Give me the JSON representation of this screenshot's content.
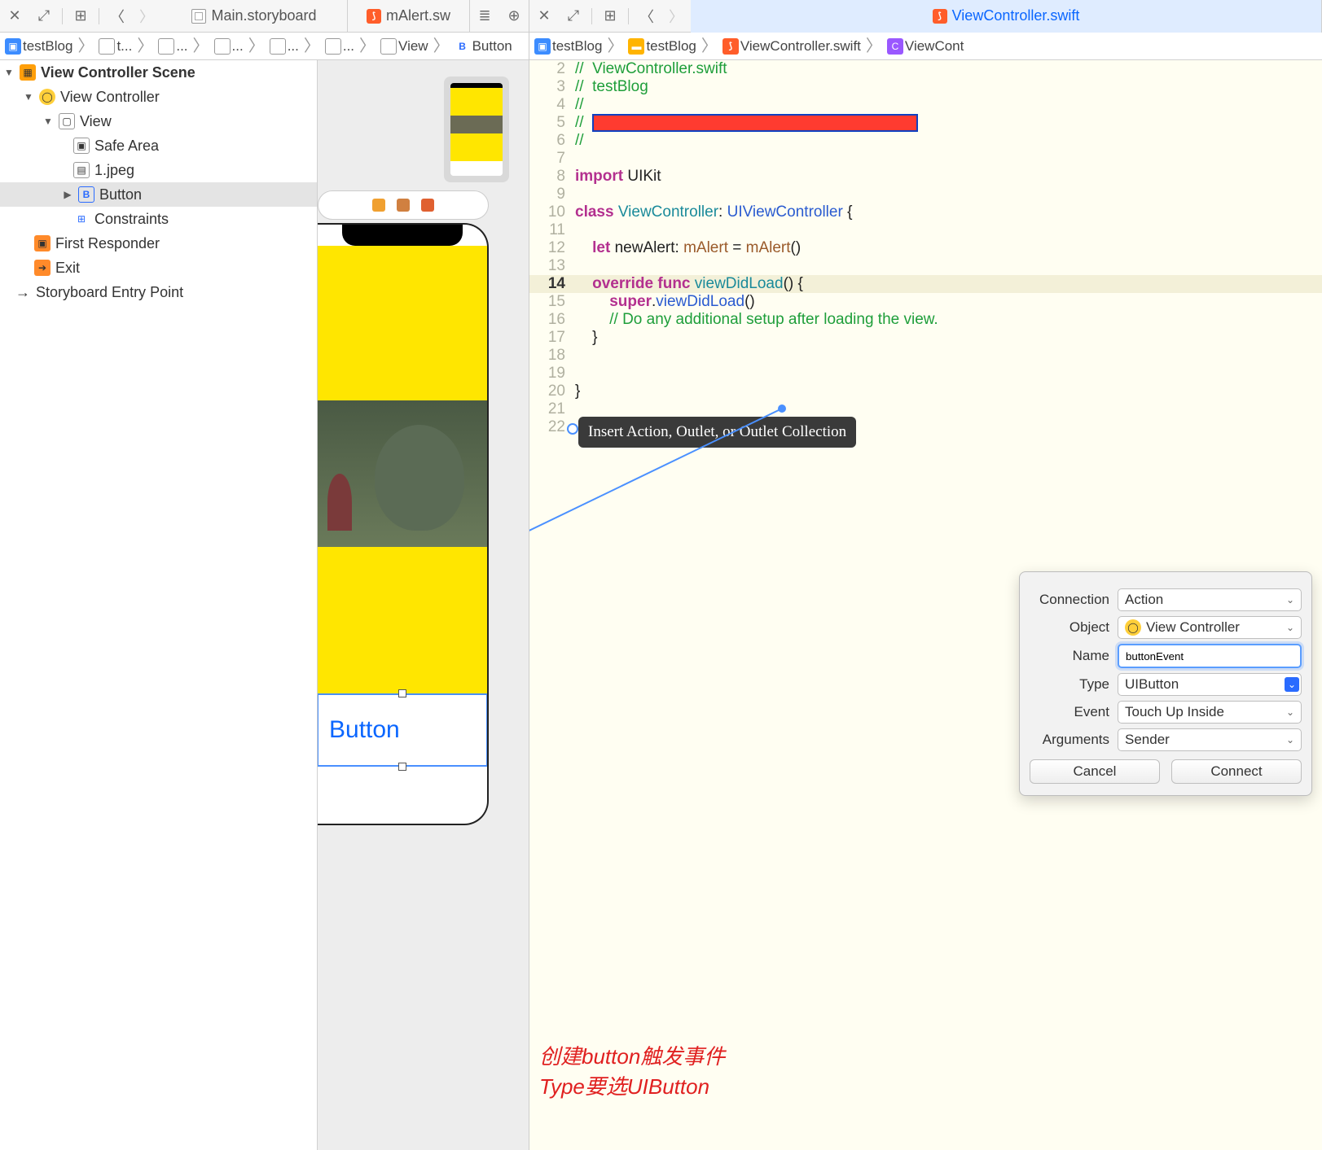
{
  "left": {
    "tabs": [
      "Main.storyboard",
      "mAlert.sw"
    ],
    "breadcrumb": [
      "testBlog",
      "t...",
      "...",
      "...",
      "...",
      "...",
      "View",
      "Button"
    ],
    "outline": {
      "scene": "View Controller Scene",
      "vc": "View Controller",
      "view": "View",
      "safeArea": "Safe Area",
      "image": "1.jpeg",
      "button": "Button",
      "constraints": "Constraints",
      "firstResponder": "First Responder",
      "exit": "Exit",
      "entry": "Storyboard Entry Point"
    },
    "canvas": {
      "buttonLabel": "Button"
    }
  },
  "right": {
    "tab": "ViewController.swift",
    "breadcrumb": [
      "testBlog",
      "testBlog",
      "ViewController.swift",
      "ViewCont"
    ],
    "code": {
      "l2": "//  ViewController.swift",
      "l3": "//  testBlog",
      "l4": "//",
      "l5pre": "//  ",
      "l6": "//",
      "l8_import": "import",
      "l8_uikit": " UIKit",
      "l10_class": "class",
      "l10_name": " ViewController",
      "l10_colon": ": ",
      "l10_super": "UIViewController",
      "l10_brace": " {",
      "l12_let": "let",
      "l12_rest": " newAlert: ",
      "l12_type": "mAlert",
      "l12_eq": " = ",
      "l12_call": "mAlert",
      "l12_par": "()",
      "l14_override": "override",
      "l14_func": " func",
      "l14_name": " viewDidLoad",
      "l14_par": "() {",
      "l15_super": "super",
      "l15_dot": ".",
      "l15_call": "viewDidLoad",
      "l15_par": "()",
      "l16": "// Do any additional setup after loading the view.",
      "l17": "    }",
      "l20": "}",
      "lines": [
        2,
        3,
        4,
        5,
        6,
        7,
        8,
        9,
        10,
        11,
        12,
        13,
        14,
        15,
        16,
        17,
        18,
        19,
        20,
        21,
        22
      ]
    },
    "insertTip": "Insert Action, Outlet, or Outlet Collection",
    "popover": {
      "labels": {
        "connection": "Connection",
        "object": "Object",
        "name": "Name",
        "type": "Type",
        "event": "Event",
        "arguments": "Arguments"
      },
      "connection": "Action",
      "object": "View Controller",
      "name": "buttonEvent",
      "type": "UIButton",
      "event": "Touch Up Inside",
      "arguments": "Sender",
      "cancel": "Cancel",
      "connect": "Connect"
    },
    "annotation1": "创建button触发事件",
    "annotation2": "Type要选UIButton"
  }
}
